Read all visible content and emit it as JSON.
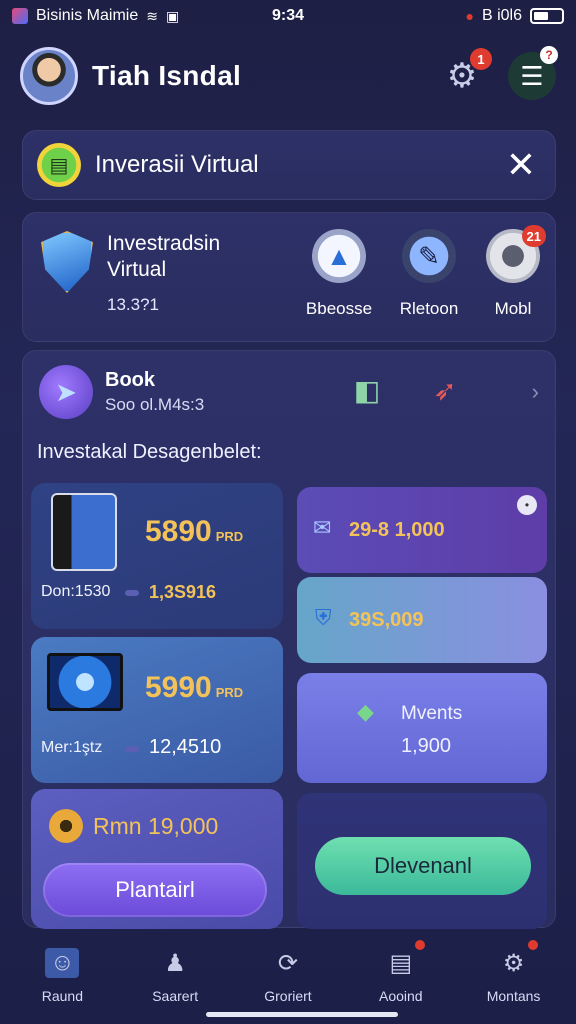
{
  "status_bar": {
    "app_name": "Bisinis Maimie",
    "time": "9:34",
    "network": "B i0l6"
  },
  "header": {
    "title": "Tiah Isndal",
    "notification_count": "1",
    "menu_badge": "?"
  },
  "banner": {
    "title": "Inverasii Virtual",
    "close": "✕"
  },
  "invest": {
    "title_line1": "Investradsin",
    "title_line2": "Virtual",
    "value": "13.3?1",
    "actions": [
      {
        "label": "Bbeosse",
        "icon": "arrow-icon"
      },
      {
        "label": "Rletoon",
        "icon": "pen-icon"
      },
      {
        "label": "Mobl",
        "icon": "disc-icon",
        "badge": "21"
      }
    ]
  },
  "main": {
    "book_title": "Book",
    "book_sub": "Soo ol.M4s:3",
    "section_label": "Investakal Desagenbelet:",
    "tiles": {
      "phone": {
        "price": "5890",
        "unit": "PRD",
        "key": "Don:1530",
        "value": "1,3S916"
      },
      "tv": {
        "price": "5990",
        "unit": "PRD",
        "key": "Mer:1ştz",
        "value": "12,4510"
      },
      "gear": {
        "amount": "Rmn 19,000",
        "button": "Plantairl"
      },
      "mail": {
        "value": "29-8 1,000"
      },
      "shield": {
        "value": "39S,009"
      },
      "mvents": {
        "title": "Mvents",
        "value": "1,900"
      },
      "green": {
        "button": "Dlevenanl"
      }
    }
  },
  "tabs": [
    {
      "label": "Raund",
      "icon": "avatar-icon"
    },
    {
      "label": "Saarert",
      "icon": "chess-icon"
    },
    {
      "label": "Groriert",
      "icon": "cycle-icon"
    },
    {
      "label": "Aooind",
      "icon": "list-icon",
      "badge": true
    },
    {
      "label": "Montans",
      "icon": "gear-icon",
      "badge": true
    }
  ],
  "colors": {
    "background": "#1e1f44",
    "accent_gold": "#f3c35a",
    "badge_red": "#e03b2f"
  }
}
